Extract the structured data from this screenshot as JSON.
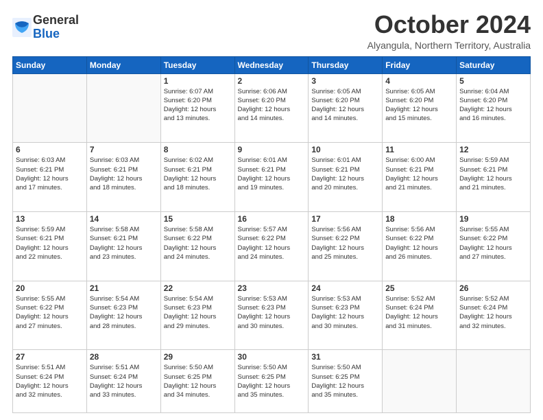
{
  "logo": {
    "line1": "General",
    "line2": "Blue"
  },
  "header": {
    "title": "October 2024",
    "subtitle": "Alyangula, Northern Territory, Australia"
  },
  "days_of_week": [
    "Sunday",
    "Monday",
    "Tuesday",
    "Wednesday",
    "Thursday",
    "Friday",
    "Saturday"
  ],
  "weeks": [
    [
      {
        "day": "",
        "info": ""
      },
      {
        "day": "",
        "info": ""
      },
      {
        "day": "1",
        "info": "Sunrise: 6:07 AM\nSunset: 6:20 PM\nDaylight: 12 hours\nand 13 minutes."
      },
      {
        "day": "2",
        "info": "Sunrise: 6:06 AM\nSunset: 6:20 PM\nDaylight: 12 hours\nand 14 minutes."
      },
      {
        "day": "3",
        "info": "Sunrise: 6:05 AM\nSunset: 6:20 PM\nDaylight: 12 hours\nand 14 minutes."
      },
      {
        "day": "4",
        "info": "Sunrise: 6:05 AM\nSunset: 6:20 PM\nDaylight: 12 hours\nand 15 minutes."
      },
      {
        "day": "5",
        "info": "Sunrise: 6:04 AM\nSunset: 6:20 PM\nDaylight: 12 hours\nand 16 minutes."
      }
    ],
    [
      {
        "day": "6",
        "info": "Sunrise: 6:03 AM\nSunset: 6:21 PM\nDaylight: 12 hours\nand 17 minutes."
      },
      {
        "day": "7",
        "info": "Sunrise: 6:03 AM\nSunset: 6:21 PM\nDaylight: 12 hours\nand 18 minutes."
      },
      {
        "day": "8",
        "info": "Sunrise: 6:02 AM\nSunset: 6:21 PM\nDaylight: 12 hours\nand 18 minutes."
      },
      {
        "day": "9",
        "info": "Sunrise: 6:01 AM\nSunset: 6:21 PM\nDaylight: 12 hours\nand 19 minutes."
      },
      {
        "day": "10",
        "info": "Sunrise: 6:01 AM\nSunset: 6:21 PM\nDaylight: 12 hours\nand 20 minutes."
      },
      {
        "day": "11",
        "info": "Sunrise: 6:00 AM\nSunset: 6:21 PM\nDaylight: 12 hours\nand 21 minutes."
      },
      {
        "day": "12",
        "info": "Sunrise: 5:59 AM\nSunset: 6:21 PM\nDaylight: 12 hours\nand 21 minutes."
      }
    ],
    [
      {
        "day": "13",
        "info": "Sunrise: 5:59 AM\nSunset: 6:21 PM\nDaylight: 12 hours\nand 22 minutes."
      },
      {
        "day": "14",
        "info": "Sunrise: 5:58 AM\nSunset: 6:21 PM\nDaylight: 12 hours\nand 23 minutes."
      },
      {
        "day": "15",
        "info": "Sunrise: 5:58 AM\nSunset: 6:22 PM\nDaylight: 12 hours\nand 24 minutes."
      },
      {
        "day": "16",
        "info": "Sunrise: 5:57 AM\nSunset: 6:22 PM\nDaylight: 12 hours\nand 24 minutes."
      },
      {
        "day": "17",
        "info": "Sunrise: 5:56 AM\nSunset: 6:22 PM\nDaylight: 12 hours\nand 25 minutes."
      },
      {
        "day": "18",
        "info": "Sunrise: 5:56 AM\nSunset: 6:22 PM\nDaylight: 12 hours\nand 26 minutes."
      },
      {
        "day": "19",
        "info": "Sunrise: 5:55 AM\nSunset: 6:22 PM\nDaylight: 12 hours\nand 27 minutes."
      }
    ],
    [
      {
        "day": "20",
        "info": "Sunrise: 5:55 AM\nSunset: 6:22 PM\nDaylight: 12 hours\nand 27 minutes."
      },
      {
        "day": "21",
        "info": "Sunrise: 5:54 AM\nSunset: 6:23 PM\nDaylight: 12 hours\nand 28 minutes."
      },
      {
        "day": "22",
        "info": "Sunrise: 5:54 AM\nSunset: 6:23 PM\nDaylight: 12 hours\nand 29 minutes."
      },
      {
        "day": "23",
        "info": "Sunrise: 5:53 AM\nSunset: 6:23 PM\nDaylight: 12 hours\nand 30 minutes."
      },
      {
        "day": "24",
        "info": "Sunrise: 5:53 AM\nSunset: 6:23 PM\nDaylight: 12 hours\nand 30 minutes."
      },
      {
        "day": "25",
        "info": "Sunrise: 5:52 AM\nSunset: 6:24 PM\nDaylight: 12 hours\nand 31 minutes."
      },
      {
        "day": "26",
        "info": "Sunrise: 5:52 AM\nSunset: 6:24 PM\nDaylight: 12 hours\nand 32 minutes."
      }
    ],
    [
      {
        "day": "27",
        "info": "Sunrise: 5:51 AM\nSunset: 6:24 PM\nDaylight: 12 hours\nand 32 minutes."
      },
      {
        "day": "28",
        "info": "Sunrise: 5:51 AM\nSunset: 6:24 PM\nDaylight: 12 hours\nand 33 minutes."
      },
      {
        "day": "29",
        "info": "Sunrise: 5:50 AM\nSunset: 6:25 PM\nDaylight: 12 hours\nand 34 minutes."
      },
      {
        "day": "30",
        "info": "Sunrise: 5:50 AM\nSunset: 6:25 PM\nDaylight: 12 hours\nand 35 minutes."
      },
      {
        "day": "31",
        "info": "Sunrise: 5:50 AM\nSunset: 6:25 PM\nDaylight: 12 hours\nand 35 minutes."
      },
      {
        "day": "",
        "info": ""
      },
      {
        "day": "",
        "info": ""
      }
    ]
  ]
}
